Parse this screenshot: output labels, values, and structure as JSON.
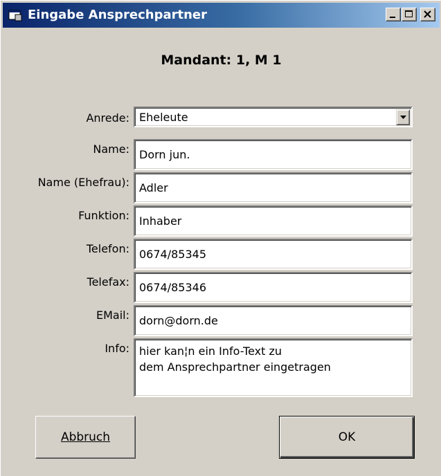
{
  "window": {
    "title": "Eingabe Ansprechpartner",
    "controls": {
      "minimize": "_",
      "maximize": "□",
      "close": "×"
    }
  },
  "header": {
    "mandant": "Mandant: 1, M 1"
  },
  "form": {
    "anrede": {
      "label": "Anrede:",
      "value": "Eheleute"
    },
    "name": {
      "label": "Name:",
      "value": "Dorn jun."
    },
    "name_ehefrau": {
      "label": "Name (Ehefrau):",
      "value": "Adler"
    },
    "funktion": {
      "label": "Funktion:",
      "value": "Inhaber"
    },
    "telefon": {
      "label": "Telefon:",
      "value": "0674/85345"
    },
    "telefax": {
      "label": "Telefax:",
      "value": "0674/85346"
    },
    "email": {
      "label": "EMail:",
      "value": "dorn@dorn.de"
    },
    "info": {
      "label": "Info:",
      "value": "hier kan¦n ein Info-Text zu\ndem Ansprechpartner eingetragen"
    }
  },
  "buttons": {
    "cancel": "Abbruch",
    "ok": "OK"
  },
  "icons": {
    "window": "app-window-icon",
    "dropdown": "chevron-down-icon"
  }
}
